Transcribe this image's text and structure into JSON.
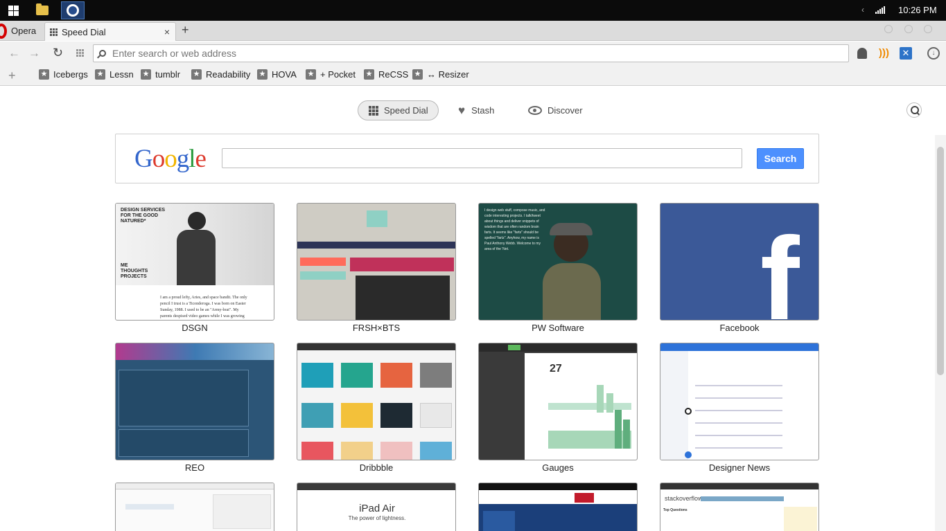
{
  "taskbar": {
    "clock": "10:26 PM"
  },
  "browser": {
    "menu_label": "Opera",
    "tab": {
      "title": "Speed Dial",
      "close": "×"
    },
    "new_tab": "+",
    "address": {
      "placeholder": "Enter search or web address",
      "value": ""
    }
  },
  "bookmarks": {
    "add": "+",
    "items": [
      {
        "label": "Icebergs"
      },
      {
        "label": "Lessn"
      },
      {
        "label": "tumblr"
      },
      {
        "label": "Readability"
      },
      {
        "label": "HOVA"
      },
      {
        "label": "+ Pocket"
      },
      {
        "label": "ReCSS"
      },
      {
        "label": "↔ Resizer"
      }
    ]
  },
  "speed_dial_nav": {
    "items": [
      {
        "label": "Speed Dial"
      },
      {
        "label": "Stash"
      },
      {
        "label": "Discover"
      }
    ]
  },
  "google": {
    "logo_letters": [
      "G",
      "o",
      "o",
      "g",
      "l",
      "e"
    ],
    "logo_colors": [
      "#3366cc",
      "#dd3b2e",
      "#f1b500",
      "#3366cc",
      "#2a9a3d",
      "#dd3b2e"
    ],
    "search_button": "Search",
    "input_value": ""
  },
  "tiles": [
    {
      "label": "DSGN",
      "text": "DESIGN SERVICES FOR THE GOOD NATURED*",
      "subtext": "ME THOUGHTS PROJECTS",
      "body": "I am a proud lefty, Aries, and space bandit. The only pencil I trust is a Ticonderoga. I was born on Easter Sunday, 1988. I used to be an \"Army-brat\". My parents despised video games while I was growing up, so I am"
    },
    {
      "label": "FRSH×BTS"
    },
    {
      "label": "PW Software",
      "text": "I design web stuff, compose music, and code interesting projects. I talk/tweet about things and deliver snippets of wisdom that are often random brain farts. It seems like \"farts\" should be spelled \"fartz\". Anyhow, my name is Paul Anthony Webb. Welcome to my area of the 'Net."
    },
    {
      "label": "Facebook",
      "brand_color": "#3b5998"
    },
    {
      "label": "REO"
    },
    {
      "label": "Dribbble"
    },
    {
      "label": "Gauges",
      "big_number": "27"
    },
    {
      "label": "Designer News"
    },
    {
      "label": ""
    },
    {
      "label": "",
      "text": "iPad Air",
      "subtext": "The power of lightness."
    },
    {
      "label": ""
    },
    {
      "label": "",
      "text": "stackoverflow",
      "subtext": "Top Questions"
    }
  ]
}
